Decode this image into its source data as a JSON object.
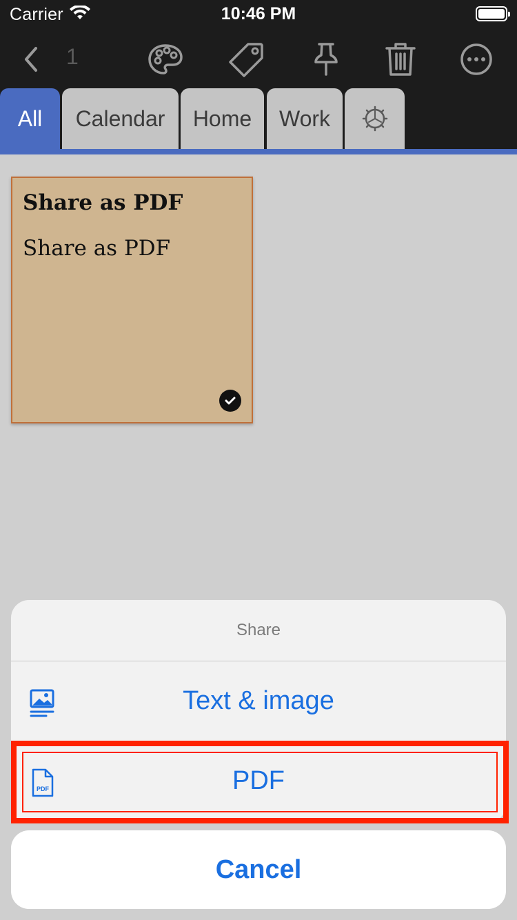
{
  "status_bar": {
    "carrier": "Carrier",
    "time": "10:46 PM",
    "wifi_icon": "wifi-icon",
    "battery_icon": "battery-icon"
  },
  "toolbar": {
    "selected_count": "1",
    "icons": [
      "back-chevron-icon",
      "palette-icon",
      "tag-icon",
      "pin-icon",
      "trash-icon",
      "more-icon"
    ]
  },
  "tabs": [
    {
      "label": "All",
      "active": true
    },
    {
      "label": "Calendar",
      "active": false
    },
    {
      "label": "Home",
      "active": false
    },
    {
      "label": "Work",
      "active": false
    },
    {
      "label": "",
      "icon": "settings-gear-icon",
      "active": false
    }
  ],
  "note": {
    "title": "Share as PDF",
    "body": "Share as PDF",
    "color": "#cfb590",
    "selected": true
  },
  "share_sheet": {
    "title": "Share",
    "options": [
      {
        "label": "Text & image",
        "icon": "image-text-icon"
      },
      {
        "label": "PDF",
        "icon": "pdf-file-icon"
      }
    ],
    "cancel_label": "Cancel",
    "icon_pdf_text": "PDF"
  },
  "colors": {
    "accent": "#1a6fe0",
    "tab_active": "#4a6bc0",
    "highlight": "#ff2200",
    "toolbar_bg": "#1c1c1c"
  }
}
